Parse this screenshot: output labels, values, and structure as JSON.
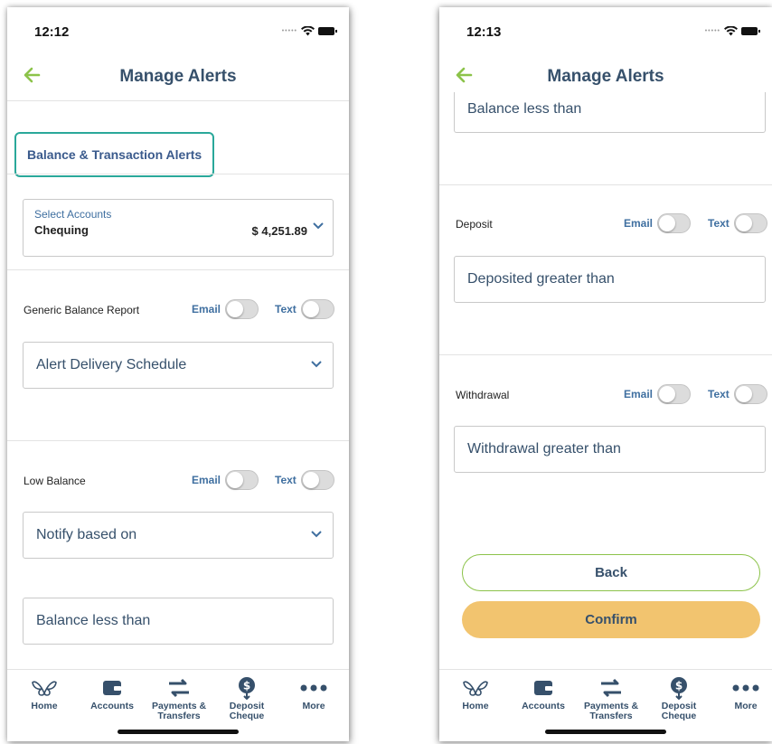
{
  "colors": {
    "accent_green": "#8cc34a",
    "teal_outline": "#2aa89a",
    "navy_text": "#36506b",
    "link_blue": "#3f6fa0",
    "confirm_button": "#f2c46f"
  },
  "left_screen": {
    "status": {
      "time": "12:12"
    },
    "header": {
      "title": "Manage Alerts"
    },
    "tab_chip": "Balance & Transaction Alerts",
    "account": {
      "label": "Select Accounts",
      "name": "Chequing",
      "amount": "$ 4,251.89"
    },
    "alerts": [
      {
        "label": "Generic Balance Report",
        "email": "Email",
        "text": "Text",
        "email_on": false,
        "text_on": false
      },
      {
        "label": "Low Balance",
        "email": "Email",
        "text": "Text",
        "email_on": false,
        "text_on": false
      }
    ],
    "fields": {
      "delivery_schedule": "Alert Delivery Schedule",
      "notify_based_on": "Notify based on",
      "balance_less_than": "Balance less than"
    }
  },
  "right_screen": {
    "status": {
      "time": "12:13"
    },
    "header": {
      "title": "Manage Alerts"
    },
    "fields": {
      "balance_less_than": "Balance less than",
      "deposited_greater_than": "Deposited greater than",
      "withdrawal_greater_than": "Withdrawal greater than"
    },
    "alerts": [
      {
        "label": "Deposit",
        "email": "Email",
        "text": "Text",
        "email_on": false,
        "text_on": false
      },
      {
        "label": "Withdrawal",
        "email": "Email",
        "text": "Text",
        "email_on": false,
        "text_on": false
      }
    ],
    "buttons": {
      "back": "Back",
      "confirm": "Confirm"
    }
  },
  "tabbar": {
    "items": [
      {
        "line1": "Home",
        "line2": "",
        "icon": "butterfly-icon"
      },
      {
        "line1": "Accounts",
        "line2": "",
        "icon": "wallet-icon"
      },
      {
        "line1": "Payments &",
        "line2": "Transfers",
        "icon": "transfer-arrows-icon"
      },
      {
        "line1": "Deposit",
        "line2": "Cheque",
        "icon": "deposit-cheque-icon"
      },
      {
        "line1": "More",
        "line2": "",
        "icon": "more-dots-icon"
      }
    ]
  }
}
